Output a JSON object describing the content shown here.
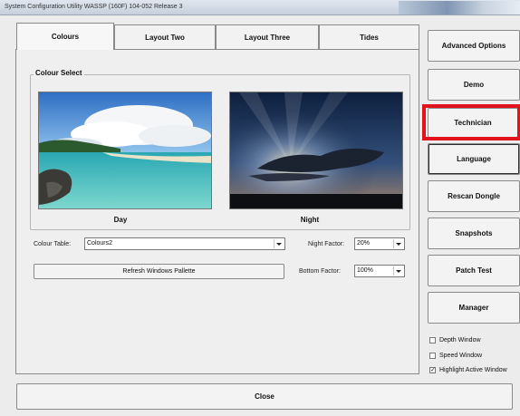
{
  "window": {
    "title": "System Configuration Utility WASSP (160F) 104-052 Release 3"
  },
  "tabs": [
    {
      "label": "Colours",
      "active": true
    },
    {
      "label": "Layout Two",
      "active": false
    },
    {
      "label": "Layout Three",
      "active": false
    },
    {
      "label": "Tides",
      "active": false
    }
  ],
  "colour_select": {
    "group_label": "Colour Select",
    "day_caption": "Day",
    "night_caption": "Night",
    "colour_table_label": "Colour Table:",
    "colour_table_value": "Colours2",
    "night_factor_label": "Night Factor:",
    "night_factor_value": "20%",
    "bottom_factor_label": "Bottom Factor:",
    "bottom_factor_value": "100%",
    "refresh_button": "Refresh Windows Pallette"
  },
  "side_buttons": [
    {
      "label": "Advanced Options"
    },
    {
      "label": "Demo"
    },
    {
      "label": "Technician",
      "highlighted": true
    },
    {
      "label": "Language",
      "focused": true
    },
    {
      "label": "Rescan Dongle"
    },
    {
      "label": "Snapshots"
    },
    {
      "label": "Patch Test"
    },
    {
      "label": "Manager"
    }
  ],
  "checkboxes": [
    {
      "label": "Depth Window",
      "checked": false
    },
    {
      "label": "Speed Window",
      "checked": false
    },
    {
      "label": "Highlight Active Window",
      "checked": true
    }
  ],
  "close_button": "Close",
  "colors": {
    "highlight": "#e2131c",
    "window_bg": "#ececec"
  }
}
